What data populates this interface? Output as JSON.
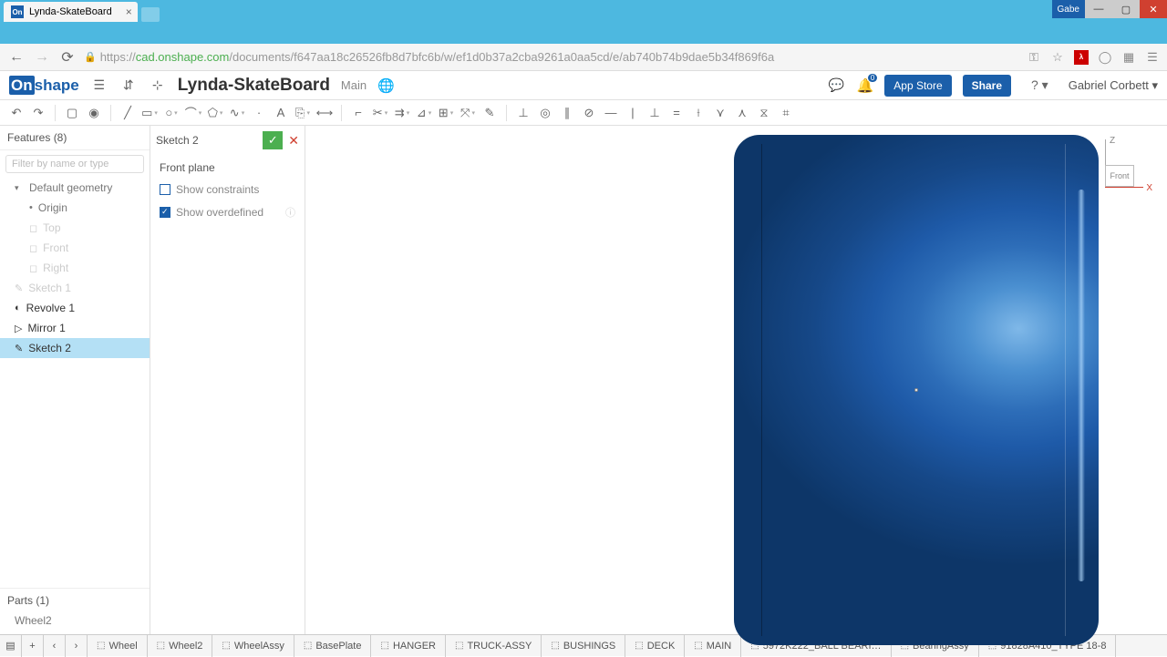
{
  "browser": {
    "tab_title": "Lynda-SkateBoard",
    "user_chip": "Gabe",
    "url_host": "cad.onshape.com",
    "url_path": "/documents/f647aa18c26526fb8d7bfc6b/w/ef1d0b37a2cba9261a0aa5cd/e/ab740b74b9dae5b34f869f6a",
    "url_prefix": "https://"
  },
  "header": {
    "logo": "Onshape",
    "doc_name": "Lynda-SkateBoard",
    "workspace": "Main",
    "appstore": "App Store",
    "share": "Share",
    "user": "Gabriel Corbett",
    "notif_count": "0"
  },
  "features": {
    "title": "Features (8)",
    "filter_placeholder": "Filter by name or type",
    "items": [
      {
        "label": "Default geometry",
        "style": "dark",
        "exp": "▾"
      },
      {
        "label": "Origin",
        "style": "dark sub",
        "icon": "•"
      },
      {
        "label": "Top",
        "style": "sub",
        "icon": "◻"
      },
      {
        "label": "Front",
        "style": "sub",
        "icon": "◻"
      },
      {
        "label": "Right",
        "style": "sub",
        "icon": "◻"
      },
      {
        "label": "Sketch 1",
        "style": "",
        "icon": "✎"
      },
      {
        "label": "Revolve 1",
        "style": "black",
        "icon": "◐"
      },
      {
        "label": "Mirror 1",
        "style": "black",
        "icon": "▷"
      },
      {
        "label": "Sketch 2",
        "style": "active",
        "icon": "✎"
      }
    ],
    "parts_title": "Parts (1)",
    "parts": [
      "Wheel2"
    ]
  },
  "sketch": {
    "title": "Sketch 2",
    "plane": "Front plane",
    "show_constraints": "Show constraints",
    "show_overdefined": "Show overdefined"
  },
  "viewcube": {
    "front": "Front"
  },
  "tabs": [
    "Wheel",
    "Wheel2",
    "WheelAssy",
    "BasePlate",
    "HANGER",
    "TRUCK-ASSY",
    "BUSHINGS",
    "DECK",
    "MAIN",
    "5972K222_BALL BEARI…",
    "BearingAssy",
    "91828A410_TYPE 18-8"
  ]
}
